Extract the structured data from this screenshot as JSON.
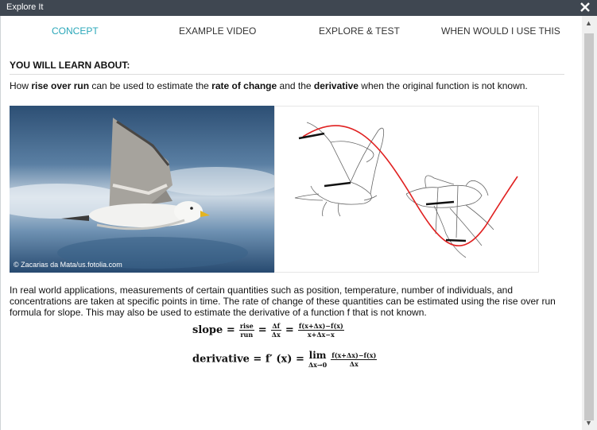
{
  "window": {
    "title": "Explore It"
  },
  "tabs": [
    {
      "label": "CONCEPT",
      "active": true
    },
    {
      "label": "EXAMPLE VIDEO",
      "active": false
    },
    {
      "label": "EXPLORE & TEST",
      "active": false
    },
    {
      "label": "WHEN WOULD I USE THIS",
      "active": false
    }
  ],
  "section": {
    "heading": "YOU WILL LEARN ABOUT:",
    "intro": {
      "t1": "How ",
      "b1": "rise over run",
      "t2": " can be used to estimate the ",
      "b2": "rate of change",
      "t3": " and the ",
      "b3": "derivative",
      "t4": " when the original function is not known."
    }
  },
  "images": {
    "photo_credit": "© Zacarias da Mata/us.fotolia.com",
    "photo_subject": "seagull-in-flight",
    "sketch_subject": "bird-sketches-with-sine-curve"
  },
  "paragraph": "In real world applications, measurements of certain quantities such as position, temperature, number of individuals, and concentrations are taken at specific points in time. The rate of change of these quantities can be estimated using the rise over run formula for slope. This may also be used to estimate the derivative of a function f that is not known.",
  "formula_slope": {
    "lhs": "slope =",
    "frac1_num": "rise",
    "frac1_den": "run",
    "eq": "=",
    "frac2_num": "Δf",
    "frac2_den": "Δx",
    "frac3_num": "f(x+Δx)−f(x)",
    "frac3_den": "x+Δx−x"
  },
  "formula_derivative": {
    "lhs": "derivative = f′ (x) =",
    "lim": "lim",
    "lim_sub": "Δx→0",
    "frac_num": "f(x+Δx)−f(x)",
    "frac_den": "Δx"
  },
  "colors": {
    "accent": "#2aa7b9",
    "titlebar": "#3f4751",
    "curve": "#e02020"
  }
}
